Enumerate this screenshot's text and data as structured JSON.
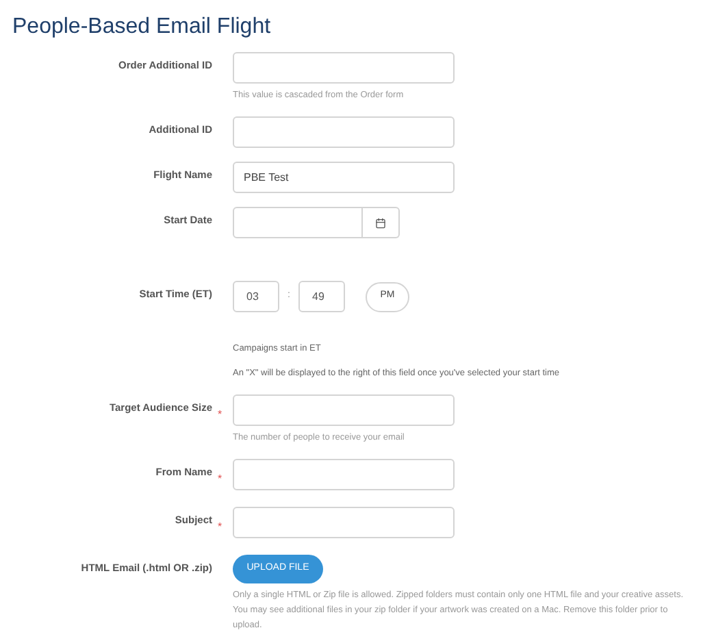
{
  "title": "People-Based Email Flight",
  "fields": [
    {
      "kind": "text",
      "label": "Order Additional ID",
      "hint": "This value is cascaded from the Order form"
    },
    {
      "kind": "text",
      "label": "Additional ID"
    },
    {
      "kind": "text",
      "label": "Flight Name",
      "value": "PBE Test"
    },
    {
      "kind": "date",
      "label": "Start Date"
    },
    {
      "kind": "time",
      "label": "Start Time (ET)",
      "hour": "03",
      "separator": ":",
      "minute": "49",
      "meridiem": "PM",
      "notes": [
        "Campaigns start in ET",
        "An \"X\" will be displayed to the right of this field once you've selected your start time"
      ]
    },
    {
      "kind": "text",
      "label": "Target Audience Size",
      "required_mark": "*",
      "hint": "The number of people to receive your email"
    },
    {
      "kind": "text",
      "label": "From Name",
      "required_mark": "*"
    },
    {
      "kind": "text",
      "label": "Subject",
      "required_mark": "*"
    },
    {
      "kind": "upload",
      "label": "HTML Email (.html OR .zip)",
      "button": "UPLOAD FILE",
      "hint": "Only a single HTML or Zip file is allowed. Zipped folders must contain only one HTML file and your creative assets. You may see additional files in your zip folder if your artwork was created on a Mac. Remove this folder prior to upload."
    }
  ]
}
